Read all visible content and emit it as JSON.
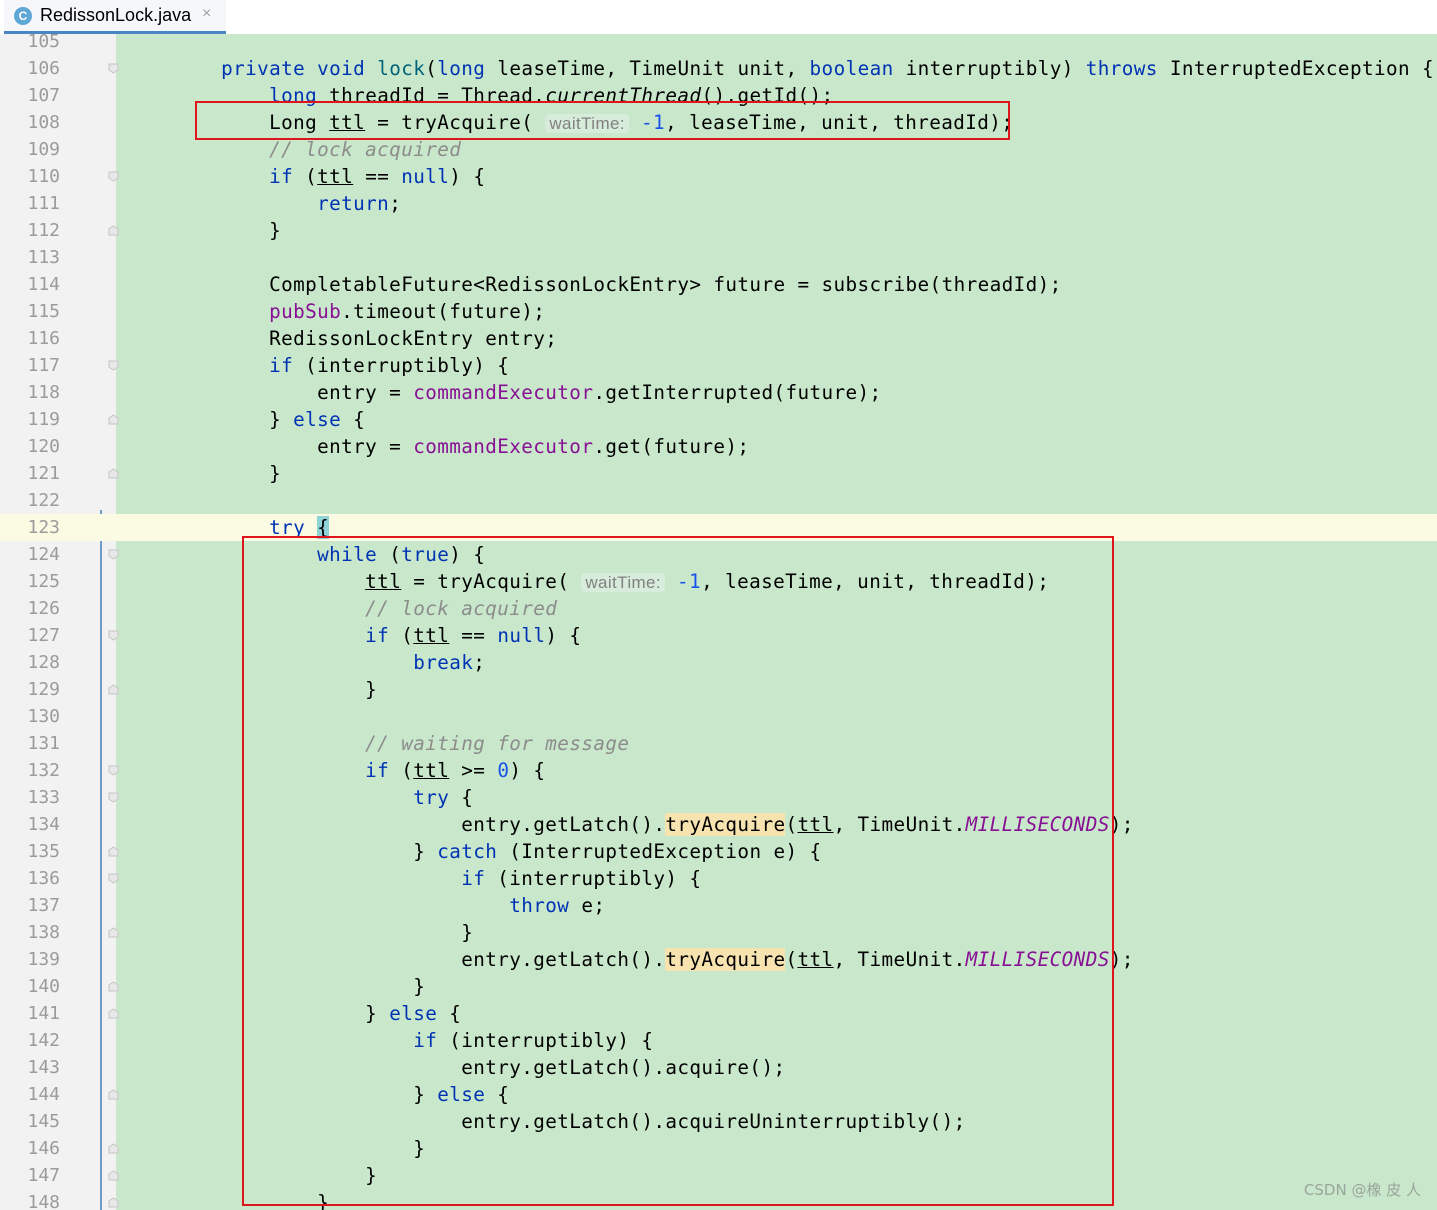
{
  "tab": {
    "icon": "C",
    "filename": "RedissonLock.java",
    "close": "×"
  },
  "lines": [
    {
      "n": "105",
      "html": ""
    },
    {
      "n": "106",
      "html": "<span class=\"kw\">private void</span> <span class=\"fn\">lock</span>(<span class=\"kw\">long</span> leaseTime, TimeUnit unit, <span class=\"kw\">boolean</span> interruptibly) <span class=\"kw\">throws</span> InterruptedException {"
    },
    {
      "n": "107",
      "html": "    <span class=\"kw\">long</span> threadId = Thread.<i>currentThread</i>().getId();"
    },
    {
      "n": "108",
      "html": "    Long <span class=\"ul\">ttl</span> = tryAcquire( <span class=\"hint\">waitTime:</span> <span class=\"num\">-1</span>, leaseTime, unit, threadId);"
    },
    {
      "n": "109",
      "html": "    <span class=\"cm\">// lock acquired</span>"
    },
    {
      "n": "110",
      "html": "    <span class=\"kw\">if</span> (<span class=\"ul\">ttl</span> == <span class=\"kw\">null</span>) {"
    },
    {
      "n": "111",
      "html": "        <span class=\"kw\">return</span>;"
    },
    {
      "n": "112",
      "html": "    }"
    },
    {
      "n": "113",
      "html": ""
    },
    {
      "n": "114",
      "html": "    CompletableFuture&lt;RedissonLockEntry&gt; future = subscribe(threadId);"
    },
    {
      "n": "115",
      "html": "    <span class=\"fld\">pubSub</span>.timeout(future);"
    },
    {
      "n": "116",
      "html": "    RedissonLockEntry entry;"
    },
    {
      "n": "117",
      "html": "    <span class=\"kw\">if</span> (interruptibly) {"
    },
    {
      "n": "118",
      "html": "        entry = <span class=\"fld\">commandExecutor</span>.getInterrupted(future);"
    },
    {
      "n": "119",
      "html": "    } <span class=\"kw\">else</span> {"
    },
    {
      "n": "120",
      "html": "        entry = <span class=\"fld\">commandExecutor</span>.get(future);"
    },
    {
      "n": "121",
      "html": "    }"
    },
    {
      "n": "122",
      "html": ""
    },
    {
      "n": "123",
      "html": "    <span class=\"kw\">try</span> <span class=\"brace-hl\">{</span>"
    },
    {
      "n": "124",
      "html": "        <span class=\"kw\">while</span> (<span class=\"kw\">true</span>) {"
    },
    {
      "n": "125",
      "html": "            <span class=\"ul\">ttl</span> = tryAcquire( <span class=\"hint\">waitTime:</span> <span class=\"num\">-1</span>, leaseTime, unit, threadId);"
    },
    {
      "n": "126",
      "html": "            <span class=\"cm\">// lock acquired</span>"
    },
    {
      "n": "127",
      "html": "            <span class=\"kw\">if</span> (<span class=\"ul\">ttl</span> == <span class=\"kw\">null</span>) {"
    },
    {
      "n": "128",
      "html": "                <span class=\"kw\">break</span>;"
    },
    {
      "n": "129",
      "html": "            }"
    },
    {
      "n": "130",
      "html": ""
    },
    {
      "n": "131",
      "html": "            <span class=\"cm\">// waiting for message</span>"
    },
    {
      "n": "132",
      "html": "            <span class=\"kw\">if</span> (<span class=\"ul\">ttl</span> &gt;= <span class=\"num\">0</span>) {"
    },
    {
      "n": "133",
      "html": "                <span class=\"kw\">try</span> {"
    },
    {
      "n": "134",
      "html": "                    entry.getLatch().<span class=\"hl\">tryAcquire</span>(<span class=\"ul\">ttl</span>, TimeUnit.<span class=\"st\">MILLISECONDS</span>);"
    },
    {
      "n": "135",
      "html": "                } <span class=\"kw\">catch</span> (InterruptedException e) {"
    },
    {
      "n": "136",
      "html": "                    <span class=\"kw\">if</span> (interruptibly) {"
    },
    {
      "n": "137",
      "html": "                        <span class=\"kw\">throw</span> e;"
    },
    {
      "n": "138",
      "html": "                    }"
    },
    {
      "n": "139",
      "html": "                    entry.getLatch().<span class=\"hl\">tryAcquire</span>(<span class=\"ul\">ttl</span>, TimeUnit.<span class=\"st\">MILLISECONDS</span>);"
    },
    {
      "n": "140",
      "html": "                }"
    },
    {
      "n": "141",
      "html": "            } <span class=\"kw\">else</span> {"
    },
    {
      "n": "142",
      "html": "                <span class=\"kw\">if</span> (interruptibly) {"
    },
    {
      "n": "143",
      "html": "                    entry.getLatch().acquire();"
    },
    {
      "n": "144",
      "html": "                } <span class=\"kw\">else</span> {"
    },
    {
      "n": "145",
      "html": "                    entry.getLatch().acquireUninterruptibly();"
    },
    {
      "n": "146",
      "html": "                }"
    },
    {
      "n": "147",
      "html": "            }"
    },
    {
      "n": "148",
      "html": "        }"
    }
  ],
  "watermark": "CSDN @橡 皮 人",
  "colors": {
    "keyword": "#0033b3",
    "field": "#871094",
    "comment": "#8c8c8c",
    "number": "#1750eb",
    "annotation_box": "#e0141b",
    "background": "#c9e8cb"
  }
}
